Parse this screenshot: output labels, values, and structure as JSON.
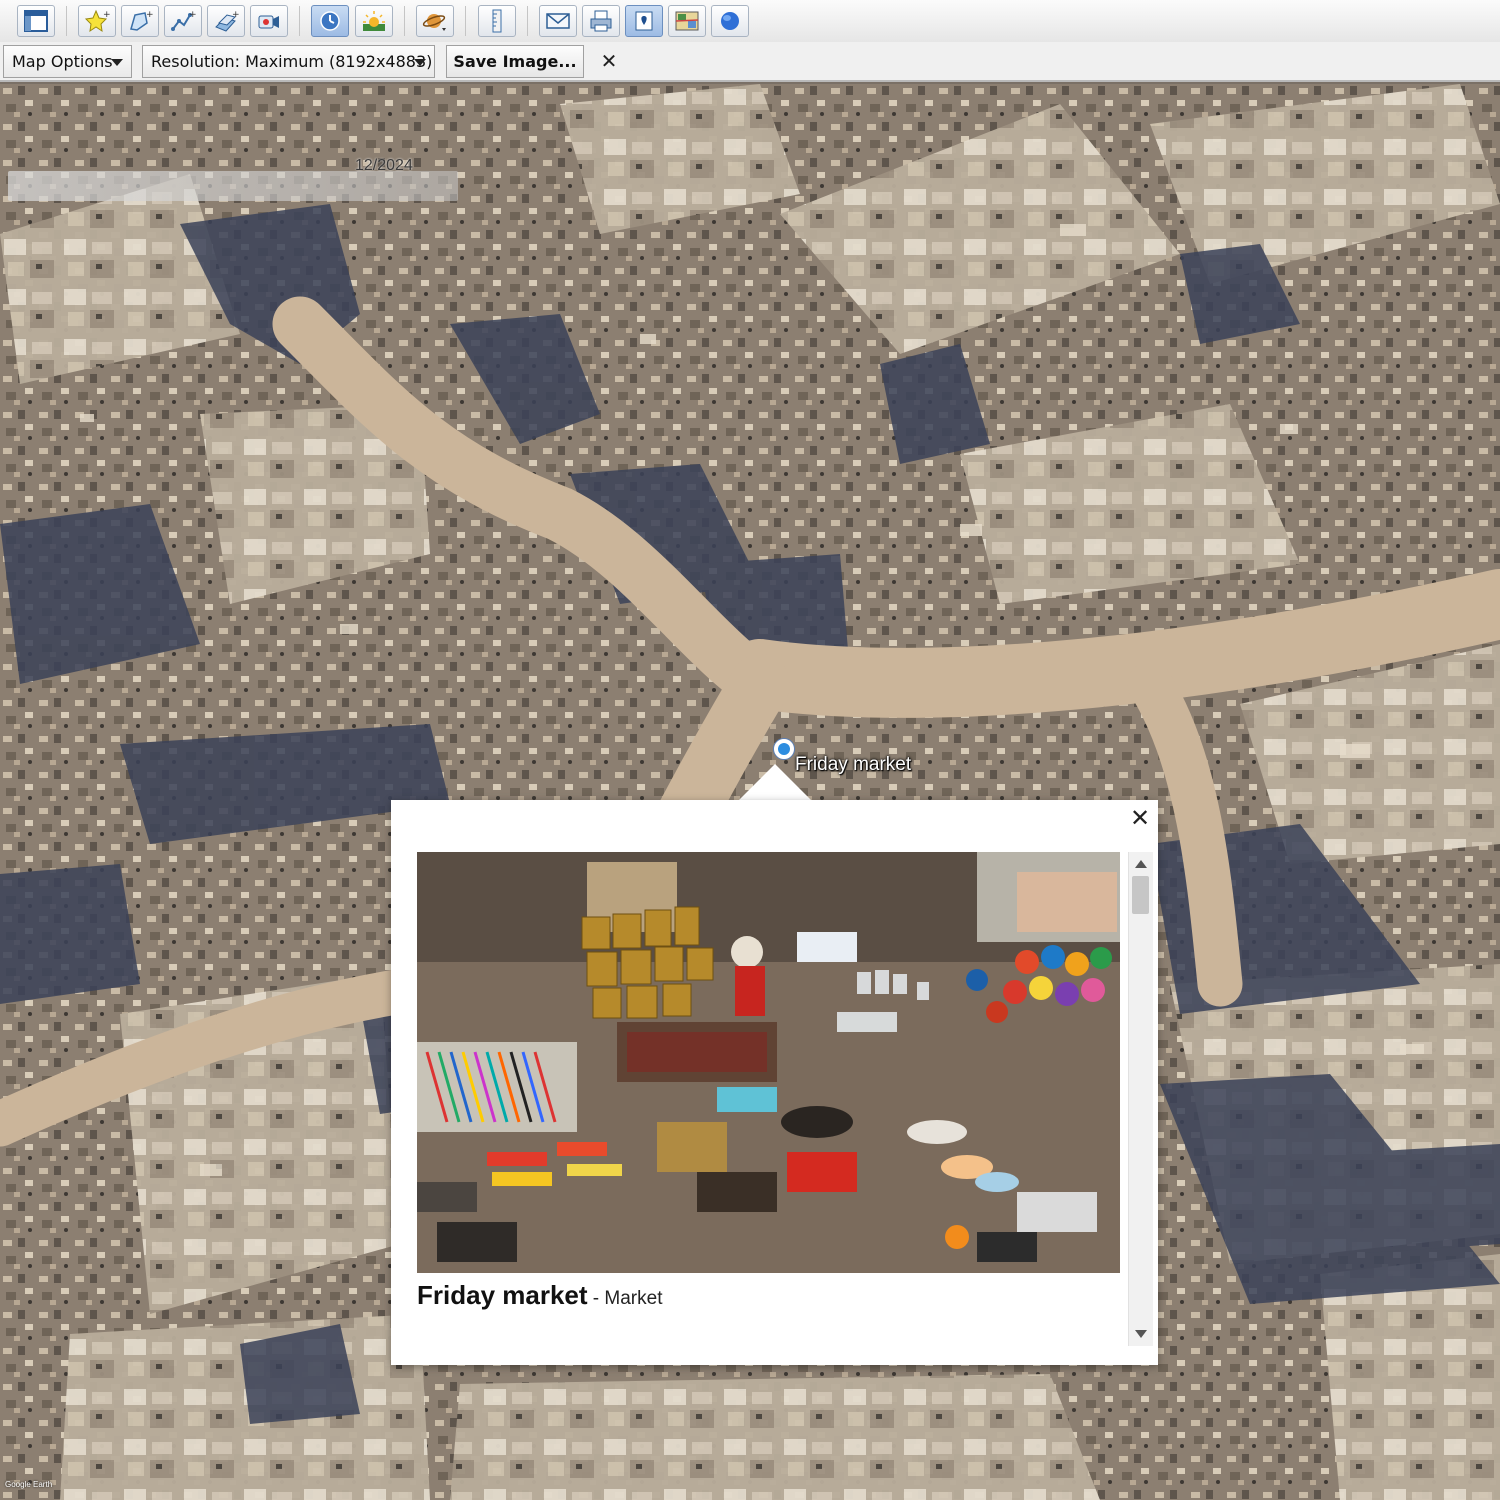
{
  "toolbar": {
    "buttons": [
      {
        "name": "sidebar-toggle-button",
        "icon": "sidebar-icon"
      },
      {
        "name": "add-placemark-button",
        "icon": "placemark-add-icon"
      },
      {
        "name": "add-polygon-button",
        "icon": "polygon-add-icon"
      },
      {
        "name": "add-path-button",
        "icon": "path-add-icon"
      },
      {
        "name": "add-image-overlay-button",
        "icon": "image-overlay-add-icon"
      },
      {
        "name": "record-tour-button",
        "icon": "record-tour-icon"
      },
      {
        "name": "historical-imagery-button",
        "icon": "clock-icon",
        "active": true
      },
      {
        "name": "sunlight-button",
        "icon": "sun-icon"
      },
      {
        "name": "planets-button",
        "icon": "planet-icon"
      },
      {
        "name": "ruler-button",
        "icon": "ruler-icon"
      },
      {
        "name": "email-button",
        "icon": "email-icon"
      },
      {
        "name": "print-button",
        "icon": "print-icon"
      },
      {
        "name": "save-image-button",
        "icon": "save-image-icon",
        "active": true
      },
      {
        "name": "view-in-maps-button",
        "icon": "map-view-icon"
      },
      {
        "name": "earth-gallery-button",
        "icon": "globe-icon"
      }
    ]
  },
  "options_bar": {
    "map_options_label": "Map Options",
    "resolution_label": "Resolution: Maximum (8192x4883)",
    "save_image_label": "Save Image...",
    "close_glyph": "✕"
  },
  "map": {
    "imagery_date": "12/2024",
    "placemark_label": "Friday market",
    "attribution": "Google Earth"
  },
  "balloon": {
    "close_glyph": "✕",
    "place_name": "Friday market",
    "place_category": " - Market"
  },
  "colors": {
    "accent_blue": "#2d8de0",
    "toolbar_active": "#9dbbe4"
  }
}
